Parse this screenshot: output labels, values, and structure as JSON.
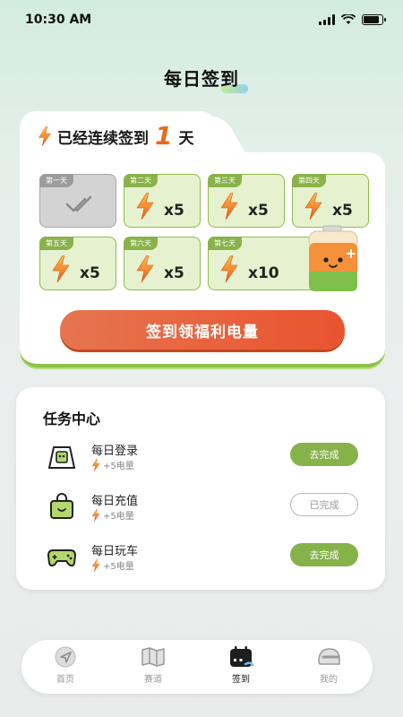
{
  "status_bar": {
    "time": "10:30 AM"
  },
  "page": {
    "title": "每日签到"
  },
  "checkin": {
    "streak_prefix": "已经连续签到",
    "streak_days": "1",
    "streak_suffix": "天",
    "days": [
      {
        "label": "第一天",
        "reward": "",
        "completed": true
      },
      {
        "label": "第二天",
        "reward": "x5",
        "completed": false
      },
      {
        "label": "第三天",
        "reward": "x5",
        "completed": false
      },
      {
        "label": "第四天",
        "reward": "x5",
        "completed": false
      },
      {
        "label": "第五天",
        "reward": "x5",
        "completed": false
      },
      {
        "label": "第六天",
        "reward": "x5",
        "completed": false
      },
      {
        "label": "第七天",
        "reward": "x10",
        "completed": false
      }
    ],
    "claim_button": "签到领福利电量"
  },
  "tasks": {
    "title": "任务中心",
    "items": [
      {
        "name": "每日登录",
        "reward": "+5电量",
        "button": "去完成",
        "done": false,
        "icon": "login-icon"
      },
      {
        "name": "每日充值",
        "reward": "+5电量",
        "button": "已完成",
        "done": true,
        "icon": "shopping-bag-icon"
      },
      {
        "name": "每日玩车",
        "reward": "+5电量",
        "button": "去完成",
        "done": false,
        "icon": "gamepad-icon"
      }
    ]
  },
  "nav": {
    "items": [
      {
        "label": "首页",
        "icon": "navigation-arrow-icon",
        "active": false
      },
      {
        "label": "赛道",
        "icon": "map-icon",
        "active": false
      },
      {
        "label": "签到",
        "icon": "calendar-icon",
        "active": true
      },
      {
        "label": "我的",
        "icon": "helmet-icon",
        "active": false
      }
    ]
  },
  "colors": {
    "accent_green": "#86b24a",
    "accent_orange": "#e9532f",
    "bolt_orange": "#f08a1c"
  }
}
